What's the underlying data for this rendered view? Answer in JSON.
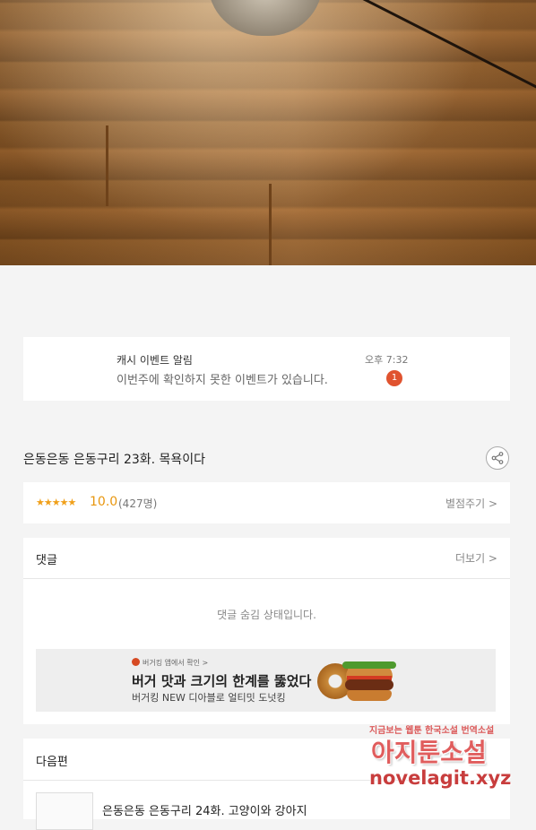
{
  "notification": {
    "title": "캐시 이벤트 알림",
    "message": "이번주에 확인하지 못한 이벤트가 있습니다.",
    "time": "오후 7:32",
    "badge_count": "1"
  },
  "episode": {
    "title": "은동은동 은동구리 23화. 목욕이다"
  },
  "rating": {
    "stars": "★★★★★",
    "score": "10.0",
    "count": "(427명)",
    "rate_link": "별점주기 >"
  },
  "comments": {
    "label": "댓글",
    "more_link": "더보기 >",
    "hidden_message": "댓글 숨김 상태입니다."
  },
  "ad": {
    "brand_line": "버거킹 앱에서 확인 >",
    "headline": "버거 맛과 크기의 한계를 뚫었다",
    "sub": "버거킹 NEW 디아블로 얼티밋 도넛킹"
  },
  "next_episode": {
    "label": "다음편",
    "title": "은동은동 은동구리 24화. 고양이와 강아지"
  },
  "watermark": {
    "line1": "지금보는 웹툰 한국소설 번역소설",
    "line2": "아지툰소설",
    "line3": "novelagit.xyz"
  },
  "colors": {
    "star": "#f0a01a",
    "badge": "#e0532f",
    "background": "#f4f4f4"
  }
}
